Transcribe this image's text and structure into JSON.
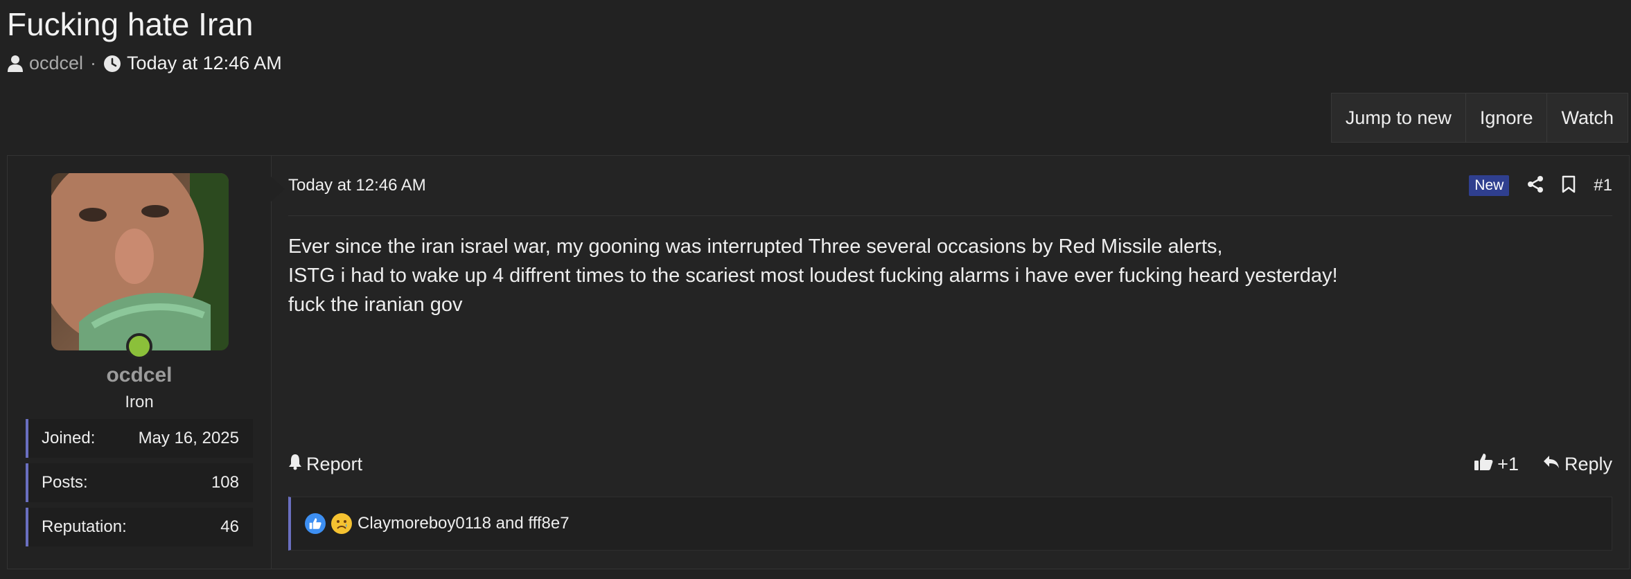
{
  "thread": {
    "title": "Fucking hate Iran",
    "author": "ocdcel",
    "separator": "·",
    "time": "Today at 12:46 AM"
  },
  "thread_buttons": [
    "Jump to new",
    "Ignore",
    "Watch"
  ],
  "user": {
    "name": "ocdcel",
    "title": "Iron",
    "status_color": "#8bc03a",
    "stats": [
      {
        "label": "Joined:",
        "value": "May 16, 2025"
      },
      {
        "label": "Posts:",
        "value": "108"
      },
      {
        "label": "Reputation:",
        "value": "46"
      }
    ]
  },
  "post": {
    "date": "Today at 12:46 AM",
    "badge": "New",
    "number": "#1",
    "body": [
      "Ever since the iran israel war, my gooning was interrupted Three several occasions by Red Missile alerts,",
      "ISTG i had to wake up 4 diffrent times to the scariest most loudest fucking alarms i have ever fucking heard yesterday!",
      "fuck the iranian gov"
    ],
    "actions": {
      "report": "Report",
      "like": "+1",
      "reply": "Reply"
    },
    "reactions": {
      "text": "Claymoreboy0118 and fff8e7",
      "icons": [
        "like-reaction-icon",
        "sad-reaction-icon"
      ]
    }
  },
  "colors": {
    "background": "#222222",
    "accent": "#6a6fc0",
    "badge_new": "#2f3f8f"
  }
}
